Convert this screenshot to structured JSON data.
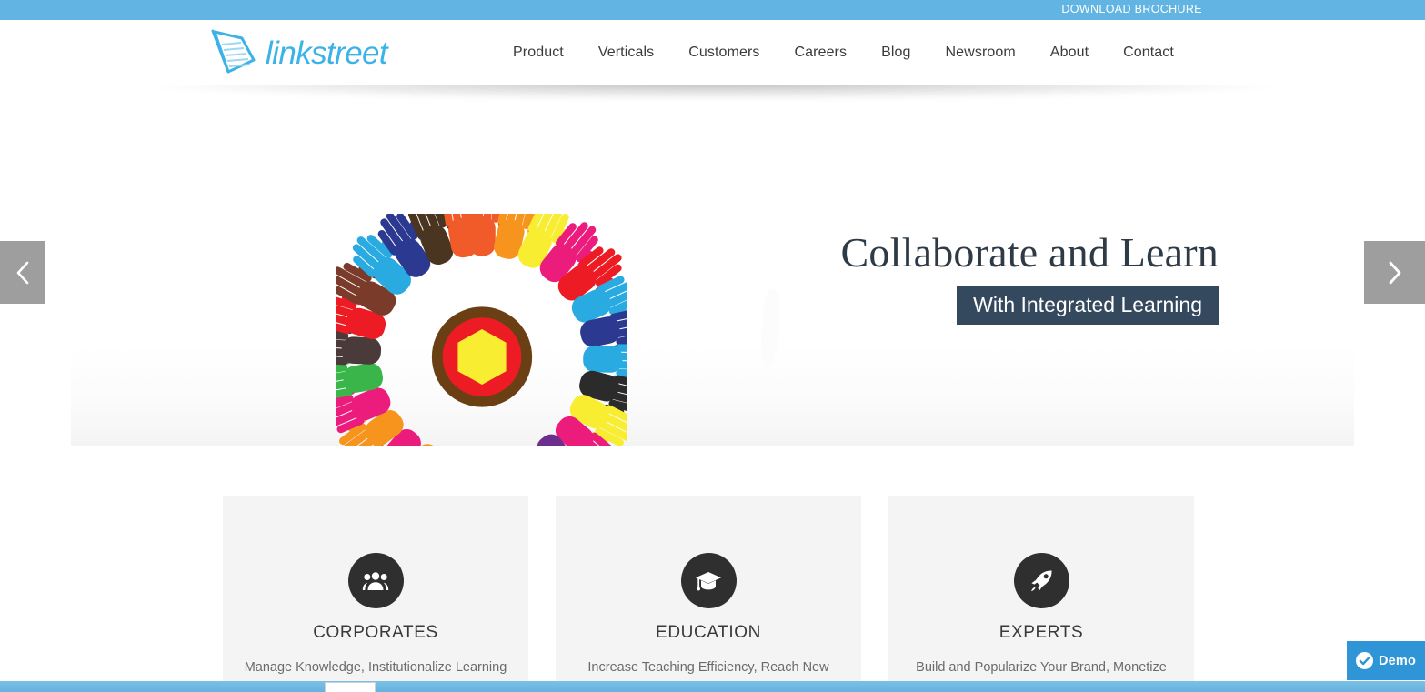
{
  "topbar": {
    "brochure_label": "DOWNLOAD BROCHURE",
    "background_color": "#62b4e2"
  },
  "header": {
    "logo_text": "linkstreet",
    "logo_color": "#3cb3e6",
    "nav": [
      {
        "label": "Product"
      },
      {
        "label": "Verticals"
      },
      {
        "label": "Customers"
      },
      {
        "label": "Careers"
      },
      {
        "label": "Blog"
      },
      {
        "label": "Newsroom"
      },
      {
        "label": "About"
      },
      {
        "label": "Contact"
      }
    ]
  },
  "hero": {
    "title": "Collaborate and Learn",
    "subtitle": "With Integrated Learning",
    "subtitle_background": "#35495e",
    "prev_label": "Previous slide",
    "next_label": "Next slide",
    "illustration_name": "circle-of-hands-illustration"
  },
  "segments": {
    "cards": [
      {
        "icon": "people-group-icon",
        "title": "CORPORATES",
        "description": "Manage Knowledge, Institutionalize Learning"
      },
      {
        "icon": "graduation-cap-icon",
        "title": "EDUCATION",
        "description": "Increase Teaching Efficiency, Reach New"
      },
      {
        "icon": "rocket-icon",
        "title": "EXPERTS",
        "description": "Build and Popularize Your Brand, Monetize"
      }
    ]
  },
  "demo_widget": {
    "label": "Demo",
    "icon": "check-circle-icon",
    "background_color": "#2f95d6"
  }
}
